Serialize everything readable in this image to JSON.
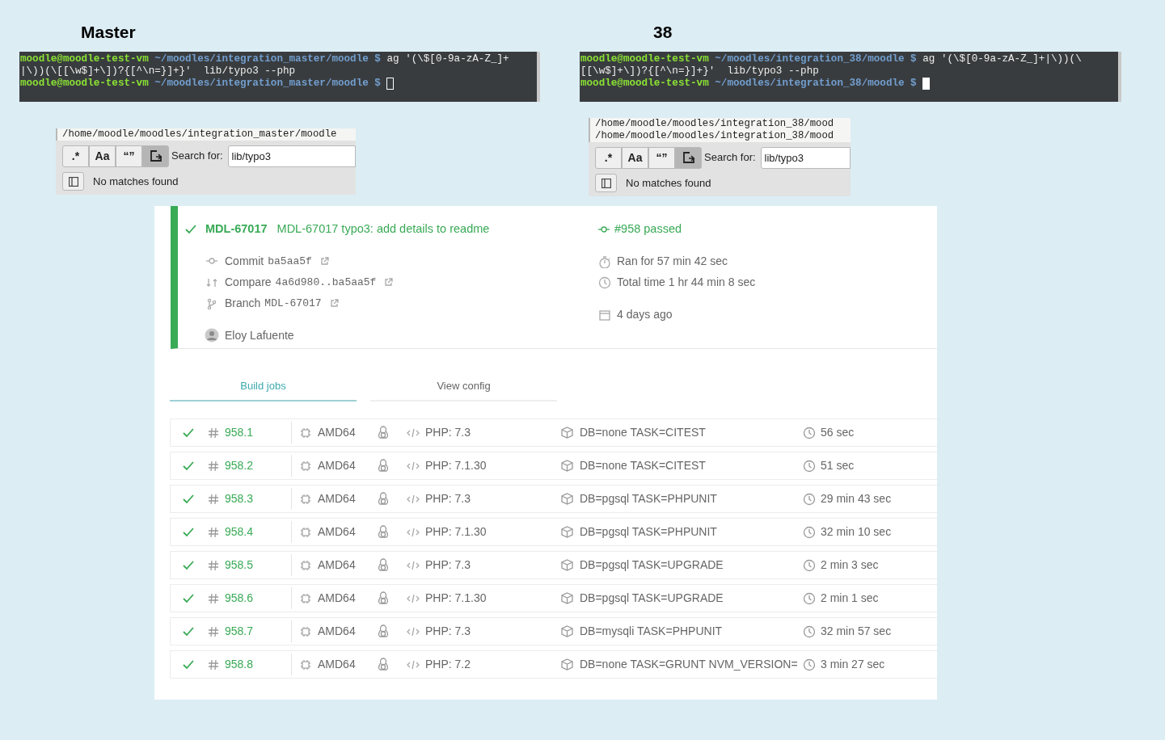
{
  "panels": [
    {
      "heading": "Master",
      "terminal": {
        "focused": false,
        "lines": [
          [
            {
              "kind": "user",
              "text": "moodle@moodle-test-vm"
            },
            {
              "kind": "path",
              "text": " ~/moodles/integration_master/moodle $"
            },
            {
              "kind": "command",
              "text": " ag '(\\$[0-9a-zA-Z_]+"
            }
          ],
          [
            {
              "kind": "command",
              "text": "|\\))(\\[[\\w$]+\\])?{[^\\n=}]+}'  lib/typo3 --php"
            }
          ],
          [
            {
              "kind": "user",
              "text": "moodle@moodle-test-vm"
            },
            {
              "kind": "path",
              "text": " ~/moodles/integration_master/moodle $"
            },
            {
              "kind": "cursor"
            }
          ]
        ]
      },
      "search": {
        "paths": [
          "/home/moodle/moodles/integration_master/moodle"
        ],
        "toggles": [
          {
            "kind": "text",
            "text": ".*",
            "selected": false
          },
          {
            "kind": "text",
            "text": "Aa",
            "selected": false
          },
          {
            "kind": "text",
            "text": "“”",
            "selected": false
          },
          {
            "kind": "icon",
            "selected": true
          }
        ],
        "label": "Search for:",
        "value": "lib/typo3",
        "status": "No matches found"
      }
    },
    {
      "heading": "38",
      "terminal": {
        "focused": true,
        "lines": [
          [
            {
              "kind": "user",
              "text": "moodle@moodle-test-vm"
            },
            {
              "kind": "path",
              "text": " ~/moodles/integration_38/moodle $"
            },
            {
              "kind": "command",
              "text": " ag '(\\$[0-9a-zA-Z_]+|\\))(\\"
            }
          ],
          [
            {
              "kind": "command",
              "text": "[[\\w$]+\\])?{[^\\n=}]+}'  lib/typo3 --php"
            }
          ],
          [
            {
              "kind": "user",
              "text": "moodle@moodle-test-vm"
            },
            {
              "kind": "path",
              "text": " ~/moodles/integration_38/moodle $"
            },
            {
              "kind": "cursor"
            }
          ]
        ]
      },
      "search": {
        "paths": [
          "/home/moodle/moodles/integration_38/mood",
          "/home/moodle/moodles/integration_38/mood"
        ],
        "toggles": [
          {
            "kind": "text",
            "text": ".*",
            "selected": false
          },
          {
            "kind": "text",
            "text": "Aa",
            "selected": false
          },
          {
            "kind": "text",
            "text": "“”",
            "selected": false
          },
          {
            "kind": "icon",
            "selected": true
          }
        ],
        "label": "Search for:",
        "value": "lib/typo3",
        "status": "No matches found"
      }
    }
  ],
  "build": {
    "passed": true,
    "branch": "MDL-67017",
    "message": "MDL-67017 typo3: add details to readme",
    "result": "#958 passed",
    "details": [
      {
        "kind": "commit",
        "label": "Commit",
        "code": "ba5aa5f"
      },
      {
        "kind": "compare",
        "label": "Compare",
        "code": "4a6d980..ba5aa5f"
      },
      {
        "kind": "branch",
        "label": "Branch",
        "code": "MDL-67017"
      }
    ],
    "author": "Eloy Lafuente",
    "info": [
      {
        "kind": "duration",
        "text": "Ran for 57 min 42 sec"
      },
      {
        "kind": "total",
        "text": "Total time 1 hr 44 min 8 sec"
      },
      {
        "kind": "date",
        "text": "4 days ago"
      }
    ],
    "tabs": [
      {
        "label": "Build jobs",
        "selected": true
      },
      {
        "label": "View config",
        "selected": false
      }
    ],
    "jobs": [
      {
        "passed": true,
        "number": "958.1",
        "arch": "AMD64",
        "php": "PHP: 7.3",
        "env": "DB=none TASK=CITEST",
        "duration": "56 sec"
      },
      {
        "passed": true,
        "number": "958.2",
        "arch": "AMD64",
        "php": "PHP: 7.1.30",
        "env": "DB=none TASK=CITEST",
        "duration": "51 sec"
      },
      {
        "passed": true,
        "number": "958.3",
        "arch": "AMD64",
        "php": "PHP: 7.3",
        "env": "DB=pgsql TASK=PHPUNIT",
        "duration": "29 min 43 sec"
      },
      {
        "passed": true,
        "number": "958.4",
        "arch": "AMD64",
        "php": "PHP: 7.1.30",
        "env": "DB=pgsql TASK=PHPUNIT",
        "duration": "32 min 10 sec"
      },
      {
        "passed": true,
        "number": "958.5",
        "arch": "AMD64",
        "php": "PHP: 7.3",
        "env": "DB=pgsql TASK=UPGRADE",
        "duration": "2 min 3 sec"
      },
      {
        "passed": true,
        "number": "958.6",
        "arch": "AMD64",
        "php": "PHP: 7.1.30",
        "env": "DB=pgsql TASK=UPGRADE",
        "duration": "2 min 1 sec"
      },
      {
        "passed": true,
        "number": "958.7",
        "arch": "AMD64",
        "php": "PHP: 7.3",
        "env": "DB=mysqli TASK=PHPUNIT",
        "duration": "32 min 57 sec"
      },
      {
        "passed": true,
        "number": "958.8",
        "arch": "AMD64",
        "php": "PHP: 7.2",
        "env": "DB=none TASK=GRUNT NVM_VERSION=",
        "duration": "3 min 27 sec"
      }
    ]
  }
}
